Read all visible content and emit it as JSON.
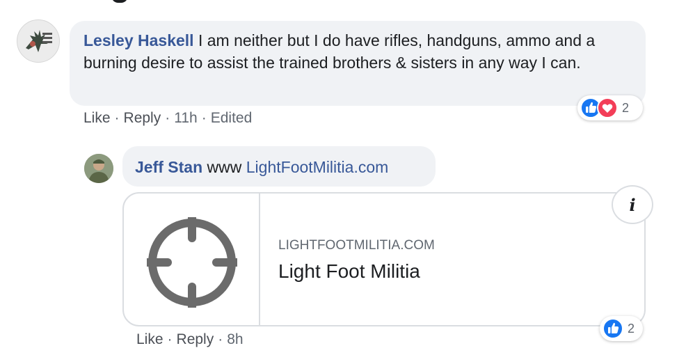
{
  "comment": {
    "author": "Lesley Haskell",
    "text": " I am neither but I do have rifles, handguns, ammo and a burning desire to assist the trained brothers & sisters in any way I can.",
    "actions": {
      "like": "Like",
      "reply": "Reply",
      "time": "11h",
      "edited": "Edited"
    },
    "reactions": {
      "icons": [
        "like-icon",
        "love-icon"
      ],
      "count": "2"
    }
  },
  "reply": {
    "author": "Jeff Stan",
    "text_prefix": " www ",
    "link_text": "LightFootMilitia.com",
    "link_preview": {
      "domain": "LIGHTFOOTMILITIA.COM",
      "title": "Light Foot Militia",
      "image_icon": "crosshair-icon",
      "info_glyph": "i"
    },
    "actions": {
      "like": "Like",
      "reply": "Reply",
      "time": "8h"
    },
    "reactions": {
      "icons": [
        "like-icon"
      ],
      "count": "2"
    }
  },
  "separator": "·",
  "colors": {
    "author_link": "#385898",
    "bubble_bg": "#f0f2f5",
    "meta_text": "#606770",
    "like_blue": "#1877f2",
    "love_red": "#f33e58"
  }
}
